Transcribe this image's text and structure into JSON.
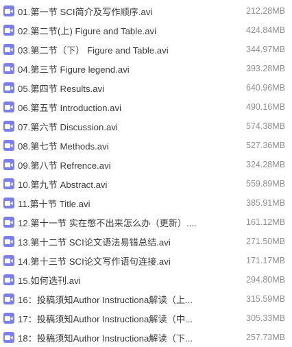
{
  "file_icon": "video-file-icon",
  "icon_color": "#7b7fe8",
  "files": [
    {
      "name": "01.第一节 SCI简介及写作顺序.avi",
      "size": "212.28MB"
    },
    {
      "name": "02.第二节(上) Figure and Table.avi",
      "size": "424.84MB"
    },
    {
      "name": "03.第二节（下） Figure and Table.avi",
      "size": "344.97MB"
    },
    {
      "name": "04.第三节 Figure legend.avi",
      "size": "393.28MB"
    },
    {
      "name": "05.第四节 Results.avi",
      "size": "640.96MB"
    },
    {
      "name": "06.第五节 Introduction.avi",
      "size": "490.16MB"
    },
    {
      "name": "07.第六节 Discussion.avi",
      "size": "574.38MB"
    },
    {
      "name": "08.第七节 Methods.avi",
      "size": "527.36MB"
    },
    {
      "name": "09.第八节 Refrence.avi",
      "size": "324.28MB"
    },
    {
      "name": "10.第九节 Abstract.avi",
      "size": "559.89MB"
    },
    {
      "name": "11.第十节 Title.avi",
      "size": "385.91MB"
    },
    {
      "name": "12.第十一节 实在憋不出来怎么办（更新）....",
      "size": "161.12MB"
    },
    {
      "name": "13.第十二节 SCI论文语法易错总结.avi",
      "size": "271.50MB"
    },
    {
      "name": "14.第十三节 SCI论文写作语句连接.avi",
      "size": "171.17MB"
    },
    {
      "name": "15.如何选刊.avi",
      "size": "294.80MB"
    },
    {
      "name": "16：投稿须知Author Instructiona解读（上...",
      "size": "315.59MB"
    },
    {
      "name": "17：投稿须知Author Instructiona解读（中...",
      "size": "305.33MB"
    },
    {
      "name": "18：投稿须知Author Instructiona解读（下...",
      "size": "257.73MB"
    }
  ]
}
